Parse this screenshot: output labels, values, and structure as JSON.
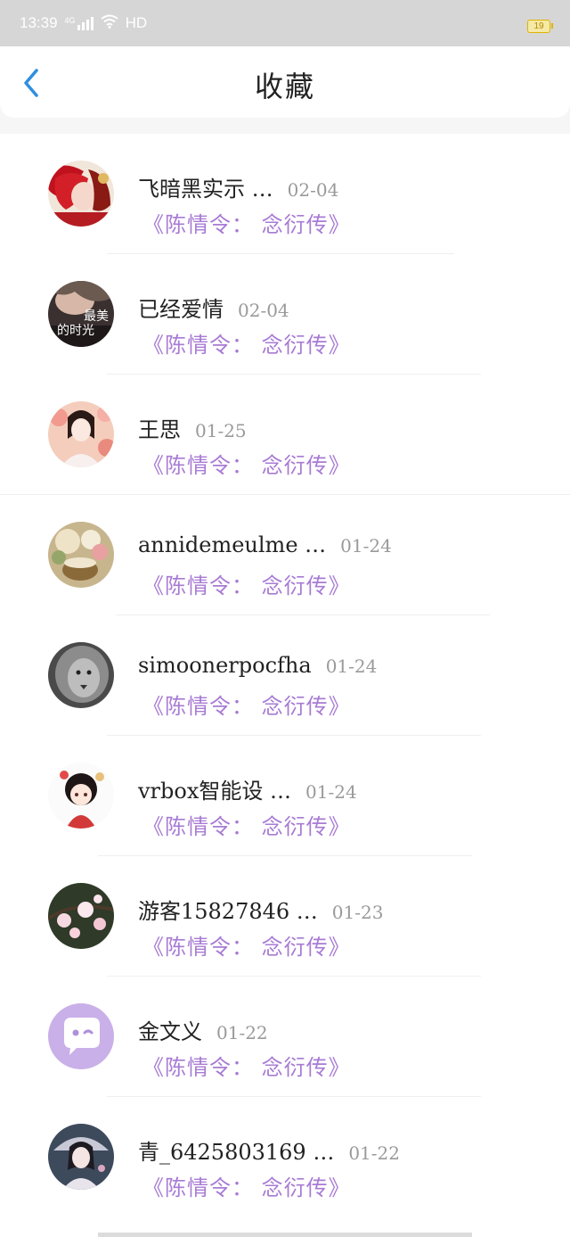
{
  "status_bar": {
    "time": "13:39",
    "network": "4G",
    "wifi_label": "HD",
    "battery": "19"
  },
  "header": {
    "title": "收藏",
    "back_icon": "chevron-left-icon"
  },
  "favorites": [
    {
      "name": "飞暗黑实示 …",
      "date": "02-04",
      "title": "《陈情令： 念衍传》",
      "avatar": "anime-red-hair"
    },
    {
      "name": "已经爱情",
      "date": "02-04",
      "title": "《陈情令： 念衍传》",
      "avatar": "book-cover-最美的时光"
    },
    {
      "name": "王思",
      "date": "01-25",
      "title": "《陈情令： 念衍传》",
      "avatar": "woman-blossoms"
    },
    {
      "name": "annidemeulme …",
      "date": "01-24",
      "title": "《陈情令： 念衍传》",
      "avatar": "flowers-cup"
    },
    {
      "name": "simoonerpocfha",
      "date": "01-24",
      "title": "《陈情令： 念衍传》",
      "avatar": "lion-grayscale"
    },
    {
      "name": "vrbox智能设 …",
      "date": "01-24",
      "title": "《陈情令： 念衍传》",
      "avatar": "chibi-girl"
    },
    {
      "name": "游客15827846 …",
      "date": "01-23",
      "title": "《陈情令： 念衍传》",
      "avatar": "plum-blossom"
    },
    {
      "name": "金文义",
      "date": "01-22",
      "title": "《陈情令： 念衍传》",
      "avatar": "default-chat-avatar"
    },
    {
      "name": "青_6425803169 …",
      "date": "01-22",
      "title": "《陈情令： 念衍传》",
      "avatar": "anime-girl-umbrella"
    }
  ],
  "avatar_text": {
    "book_cover_line1": "最美",
    "book_cover_line2": "的时光"
  },
  "colors": {
    "accent_blue": "#2f8fe0",
    "title_purple": "#a87bd4",
    "default_avatar_bg": "#c9b0e8"
  }
}
